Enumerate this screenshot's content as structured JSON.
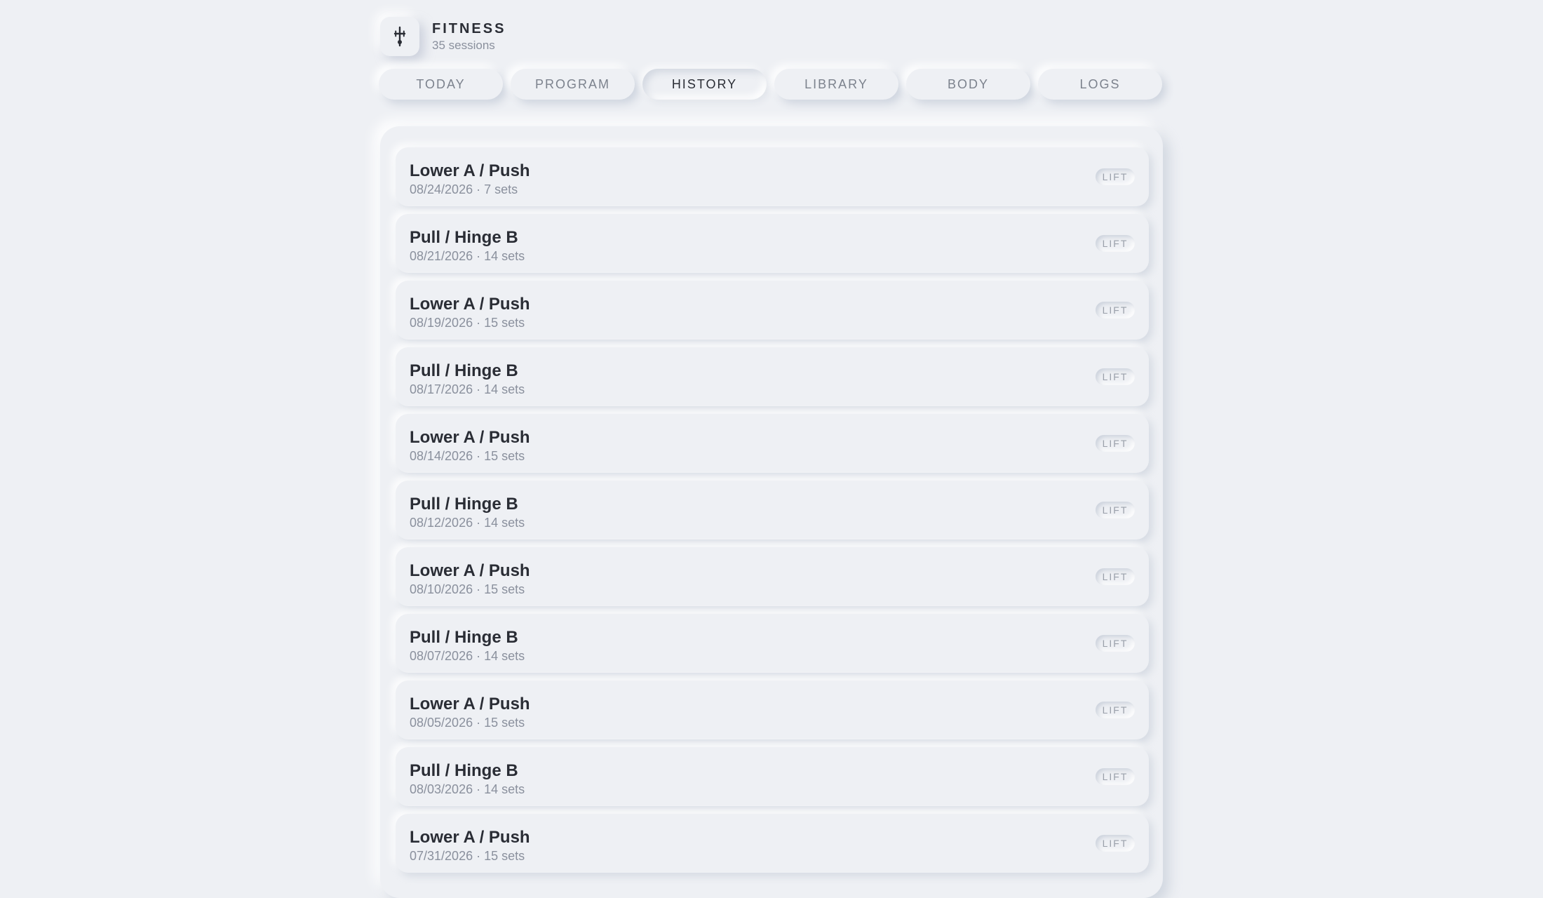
{
  "app": {
    "title": "FITNESS",
    "subtitle": "35 sessions",
    "logo_icon": "fitness-icon"
  },
  "tabs": [
    {
      "label": "TODAY",
      "active": false
    },
    {
      "label": "PROGRAM",
      "active": false
    },
    {
      "label": "HISTORY",
      "active": true
    },
    {
      "label": "LIBRARY",
      "active": false
    },
    {
      "label": "BODY",
      "active": false
    },
    {
      "label": "LOGS",
      "active": false
    }
  ],
  "sessions": [
    {
      "name": "Lower A / Push",
      "meta": "08/24/2026 · 7 sets",
      "badge": "LIFT"
    },
    {
      "name": "Pull / Hinge B",
      "meta": "08/21/2026 · 14 sets",
      "badge": "LIFT"
    },
    {
      "name": "Lower A / Push",
      "meta": "08/19/2026 · 15 sets",
      "badge": "LIFT"
    },
    {
      "name": "Pull / Hinge B",
      "meta": "08/17/2026 · 14 sets",
      "badge": "LIFT"
    },
    {
      "name": "Lower A / Push",
      "meta": "08/14/2026 · 15 sets",
      "badge": "LIFT"
    },
    {
      "name": "Pull / Hinge B",
      "meta": "08/12/2026 · 14 sets",
      "badge": "LIFT"
    },
    {
      "name": "Lower A / Push",
      "meta": "08/10/2026 · 15 sets",
      "badge": "LIFT"
    },
    {
      "name": "Pull / Hinge B",
      "meta": "08/07/2026 · 14 sets",
      "badge": "LIFT"
    },
    {
      "name": "Lower A / Push",
      "meta": "08/05/2026 · 15 sets",
      "badge": "LIFT"
    },
    {
      "name": "Pull / Hinge B",
      "meta": "08/03/2026 · 14 sets",
      "badge": "LIFT"
    },
    {
      "name": "Lower A / Push",
      "meta": "07/31/2026 · 15 sets",
      "badge": "LIFT"
    }
  ],
  "colors": {
    "background": "#eef0f4",
    "text_primary": "#2a2d35",
    "text_secondary": "#8a909d",
    "badge_text": "#9aa0aa"
  }
}
